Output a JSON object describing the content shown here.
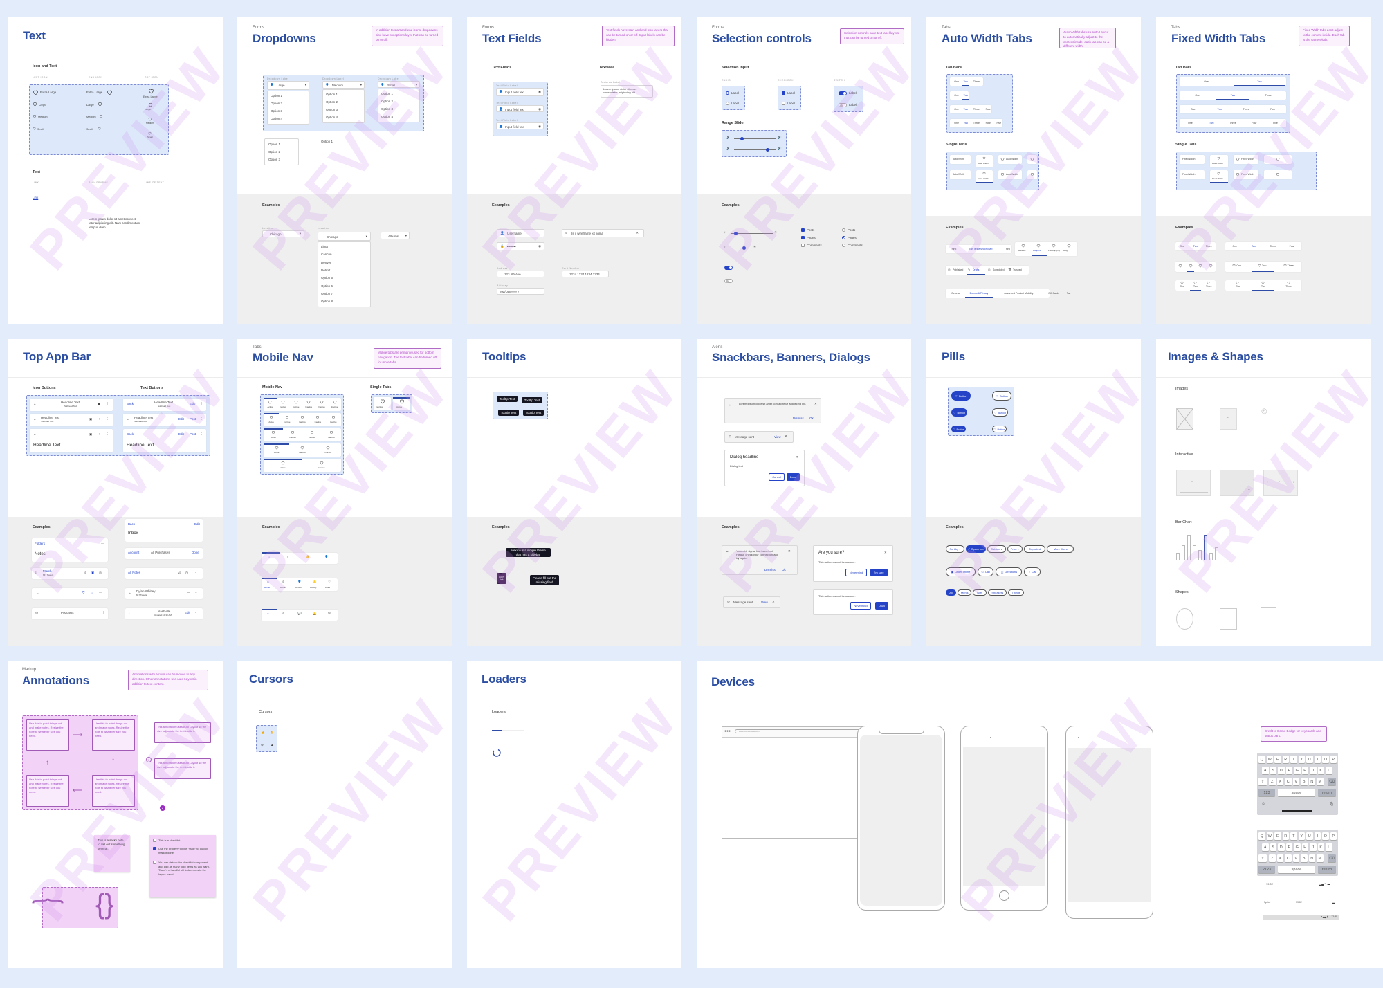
{
  "watermark": "PREVIEW",
  "panels": {
    "text": {
      "title": "Text",
      "icon_and_text": {
        "heading": "Icon and Text",
        "columns": [
          "LEFT ICON",
          "END ICON",
          "TOP ICON"
        ],
        "sizes": [
          "Extra Large",
          "Large",
          "Medium",
          "Small"
        ]
      },
      "text_section": {
        "heading": "Text",
        "columns": [
          "LINK",
          "PARAGRAPHS",
          "LINE OF TEXT"
        ],
        "link": "Link",
        "paragraph": "Lorem ipsum dolor sit amet consect tetur adipiscing elit. Nam condimentum tempus diam."
      }
    },
    "dropdowns": {
      "kicker": "Forms",
      "title": "Dropdowns",
      "note": "In addition to start and end icons, dropdowns also have six options layer that can be turned on or off.",
      "field_label": "Dropdown Label",
      "variants": [
        {
          "value": "Large",
          "options": [
            "Option 1",
            "Option 2",
            "Option 3",
            "Option 4"
          ]
        },
        {
          "value": "Medium",
          "options": [
            "Option 1",
            "Option 2",
            "Option 3",
            "Option 4"
          ]
        },
        {
          "value": "Small",
          "options": [
            "Option 1",
            "Option 2",
            "Option 3",
            "Option 4"
          ]
        }
      ],
      "standalone_list": [
        "Option 1",
        "Option 2",
        "Option 3"
      ],
      "standalone_item": "Option 1",
      "examples": {
        "heading": "Examples",
        "location_label": "Location",
        "location_value": "Chicago",
        "city_label": "Location",
        "city_value": "Chicago",
        "city_options": [
          "Lima",
          "Cancun",
          "Denver",
          "Detroit",
          "Option 5",
          "Option 6",
          "Option 7",
          "Option 8"
        ],
        "sort_value": "Albums"
      }
    },
    "text_fields": {
      "kicker": "Forms",
      "title": "Text Fields",
      "note": "Text fields have start and end icon layers that can be turned on or off. Input labels can be hidden.",
      "section_label": "Text Fields",
      "textarea_label": "Textarea",
      "field_label": "Text Field Label",
      "field_value": "Input field text",
      "textarea_field_label": "Textarea Label",
      "textarea_value": "Lorem ipsum dolor sit amet consectetur adipiscing elit.",
      "examples": {
        "heading": "Examples",
        "username": "Username",
        "password": "••••••••",
        "search": "Is it wireframe kit figma",
        "address_label": "Address",
        "address": "123 5th Ave.",
        "card_label": "Card Number",
        "card": "1234 1234 1234 1234",
        "birthday_label": "Birthday",
        "birthday": "MM/DD/YYYY"
      }
    },
    "selection": {
      "kicker": "Forms",
      "title": "Selection controls",
      "note": "Selection controls have text label layers that can be turned on or off.",
      "section_label": "Selection Input",
      "columns": [
        "RADIO",
        "CHECKBOX",
        "SWITCH"
      ],
      "option_label": "Label",
      "range_label": "Range Slider",
      "examples": {
        "heading": "Examples",
        "checkboxes": [
          {
            "label": "Posts",
            "checked": true
          },
          {
            "label": "Pages",
            "checked": true
          },
          {
            "label": "Comments",
            "checked": false
          }
        ],
        "radios": [
          {
            "label": "Posts",
            "checked": false
          },
          {
            "label": "Pages",
            "checked": true
          },
          {
            "label": "Comments",
            "checked": false
          }
        ],
        "slider1_value": 0.1,
        "slider2_value": 0.6
      }
    },
    "auto_tabs": {
      "kicker": "Tabs",
      "title": "Auto Width Tabs",
      "note": "Auto Width tabs use Auto Layout to automatically adjust to the content inside, each tab can be a different width.",
      "tab_bars_label": "Tab Bars",
      "tabs": [
        "One",
        "Two",
        "Three",
        "Four",
        "Five"
      ],
      "single_label": "Single Tabs",
      "single_text": "Auto Width",
      "examples": {
        "heading": "Examples",
        "bar1": [
          "First",
          "This is the second tab",
          "Third"
        ],
        "bar2": [
          "Reviews",
          "Happens",
          "Photography",
          "Blog"
        ],
        "bar3": [
          "Published",
          "Drafts",
          "Scheduled",
          "Trashed"
        ],
        "bar4": [
          "General",
          "Brands & Privacy",
          "Advanced Product Visibility",
          "Gift Cards",
          "Tax"
        ]
      }
    },
    "fixed_tabs": {
      "kicker": "Tabs",
      "title": "Fixed Width Tabs",
      "note": "Fixed Width tabs don't adjust to the content inside. Each tab is the same width.",
      "tab_bars_label": "Tab Bars",
      "tabs": [
        "One",
        "Two",
        "Three",
        "Four",
        "Five"
      ],
      "single_label": "Single Tabs",
      "single_text": "Fixed Width",
      "examples": {
        "heading": "Examples",
        "tabs3": [
          "One",
          "Two",
          "Three"
        ],
        "tabs4": [
          "One",
          "Two",
          "Three",
          "Four"
        ]
      }
    },
    "top_app_bar": {
      "title": "Top App Bar",
      "icon_buttons_label": "Icon Buttons",
      "text_buttons_label": "Text Buttons",
      "headline": "Headline Text",
      "subhead": "Subhead Text",
      "back": "Back",
      "edit": "Edit",
      "post": "Post",
      "examples": {
        "heading": "Examples",
        "folders": "Folders",
        "notes": "Notes",
        "inbox_back": "Back",
        "inbox_edit": "Edit",
        "inbox": "Inbox",
        "account": "Account",
        "all_purchases": "All Purchases",
        "done": "Done",
        "all_notes": "All Notes",
        "month": "March",
        "month_sub": "847 Tweets",
        "profile": "Dylan Whitley",
        "profile_sub": "847 Tweets",
        "podcasts": "Podcasts",
        "nashville": "Nashville",
        "nashville_sub": "Updated 10:30 AM"
      }
    },
    "mobile_nav": {
      "kicker": "Tabs",
      "title": "Mobile Nav",
      "note": "Mobile tabs are primarily used for bottom navigation. The text label can be turned off for more tabs.",
      "section_label": "Mobile Nav",
      "single_label": "Single Tabs",
      "item_active": "Active",
      "item_inactive": "Inactive",
      "examples": {
        "heading": "Examples",
        "labels": [
          "Home",
          "Explore",
          "Account",
          "Activity",
          "Likes"
        ]
      }
    },
    "tooltips": {
      "title": "Tooltips",
      "tip_text": "Tooltip Text",
      "examples": {
        "heading": "Examples",
        "tip1": "Mexico is a simple theme that has a sidebar",
        "tip2": "Copy link",
        "tip3": "Please fill out the missing field"
      }
    },
    "snackbars": {
      "kicker": "Alerts",
      "title": "Snackbars, Banners, Dialogs",
      "banner_text": "Lorem ipsum dolor sit amet consec tetur adipiscing elit.",
      "dismiss": "Dismiss",
      "ok": "Ok",
      "snack_text": "Message sent",
      "view": "View",
      "dialog_headline": "Dialog headline",
      "dialog_text": "Dialog text",
      "cancel": "Cancel",
      "done": "Done",
      "examples": {
        "heading": "Examples",
        "banner": "Your wi-fi signal has been lost. Please check your connection and try again.",
        "are_you_sure": "Are you sure?",
        "cannot_undo": "This action cannot be undone.",
        "nevermind": "Nevermind",
        "im_sure": "I'm sure",
        "never_mind2": "Nevermind",
        "okay": "Okay"
      }
    },
    "pills": {
      "title": "Pills",
      "button_label": "Button",
      "examples": {
        "heading": "Examples",
        "row1": [
          "Sort by",
          "Open now",
          "Cuisine",
          "Price",
          "Top rated",
          "More filters"
        ],
        "row2": [
          "Order online",
          "Call",
          "Directions",
          "Call"
        ],
        "row3": [
          "All",
          "Men's",
          "Gifts",
          "Sneakers",
          "Things"
        ]
      }
    },
    "images": {
      "title": "Images & Shapes",
      "images_label": "Images",
      "interactive_label": "Interactive",
      "bar_chart_label": "Bar Chart",
      "bar_values": [
        0.3,
        0.6,
        1.0,
        0.6,
        0.4,
        1.0,
        0.3,
        0.5
      ],
      "highlight_index": 5,
      "shapes_label": "Shapes"
    },
    "annotations": {
      "kicker": "Markup",
      "title": "Annotations",
      "note": "Annotations with arrows can be moved to any direction. Other annotations use Auto Layout in addition to text content.",
      "flow_text": "Use this to point things out and make notes. Resize the note to whatever size you need.",
      "side1": "This annotation uses Auto Layout so the size adjusts to the text inside it.",
      "side2": "This annotation uses Auto Layout so the size adjusts to the text inside it.",
      "sticky": "This is a sticky note to call out something general.",
      "checklist": [
        {
          "label": "This is a checklist.",
          "checked": false
        },
        {
          "label": "Use the property toggle \"state\" to quickly mark it done.",
          "checked": true
        },
        {
          "label": "You can detach the checklist component and add as many todo items as you want. There's a handful of hidden ones in the layers panel.",
          "checked": false
        }
      ],
      "marker1": "1",
      "marker2": "2"
    },
    "cursors": {
      "title": "Cursors",
      "section_label": "Cursors"
    },
    "loaders": {
      "title": "Loaders",
      "section_label": "Loaders",
      "progress": 0.3
    },
    "devices": {
      "title": "Devices",
      "browser_url": "www.yourwebsite.com",
      "note": "Credit to Damo Bodge for keyboards and status bars.",
      "keyboard_rows": [
        [
          "Q",
          "W",
          "E",
          "R",
          "T",
          "Y",
          "U",
          "I",
          "O",
          "P"
        ],
        [
          "A",
          "S",
          "D",
          "F",
          "G",
          "H",
          "J",
          "K",
          "L"
        ],
        [
          "Z",
          "X",
          "C",
          "V",
          "B",
          "N",
          "M"
        ]
      ],
      "kb1_keys": {
        "numbers": "123",
        "space": "space",
        "return": "return"
      },
      "kb2_keys": {
        "numbers": "?123",
        "space": "space",
        "return": "return"
      },
      "ios_time": "19:02",
      "ios_carrier": "Sprint",
      "ios_time2": "19:02",
      "android_time": "12:30"
    }
  }
}
